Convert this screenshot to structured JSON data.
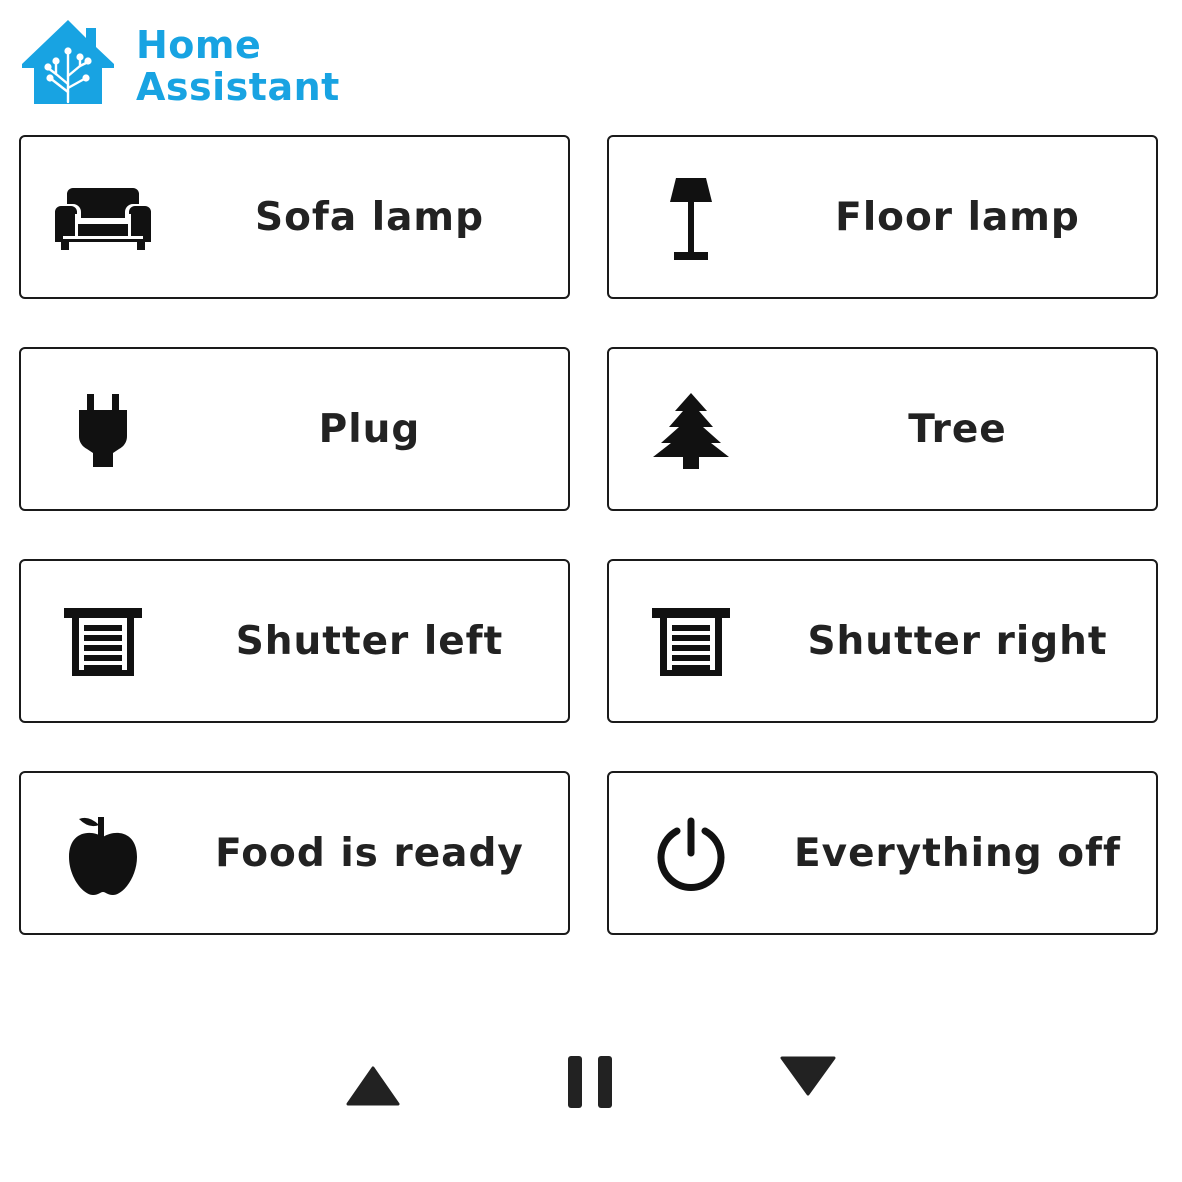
{
  "app": {
    "logo_line1": "Home",
    "logo_line2": "Assistant",
    "brand_color": "#18a3e2"
  },
  "tiles": [
    {
      "label": "Sofa lamp",
      "icon": "sofa-icon"
    },
    {
      "label": "Floor lamp",
      "icon": "floor-lamp-icon"
    },
    {
      "label": "Plug",
      "icon": "plug-icon"
    },
    {
      "label": "Tree",
      "icon": "tree-icon"
    },
    {
      "label": "Shutter left",
      "icon": "shutter-icon"
    },
    {
      "label": "Shutter right",
      "icon": "shutter-icon"
    },
    {
      "label": "Food is ready",
      "icon": "apple-icon"
    },
    {
      "label": "Everything off",
      "icon": "power-icon"
    }
  ],
  "controls": [
    {
      "icon": "arrow-up-icon"
    },
    {
      "icon": "pause-icon"
    },
    {
      "icon": "arrow-down-icon"
    }
  ]
}
